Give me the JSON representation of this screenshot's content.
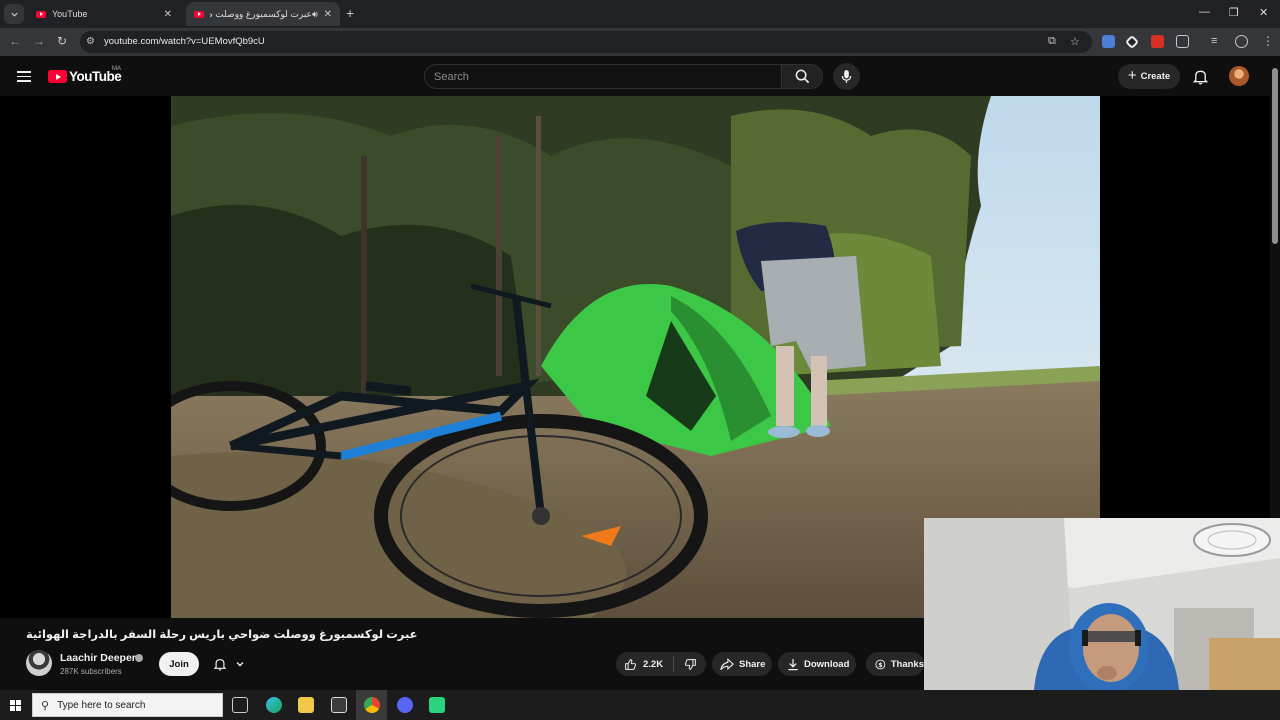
{
  "browser": {
    "tabs": [
      {
        "title": "YouTube",
        "active": false
      },
      {
        "title": "عبرت لوكسمبورغ ووصلت ض",
        "active": true,
        "audio": true
      }
    ],
    "new_tab_label": "+",
    "url": "youtube.com/watch?v=UEMovfQb9cU",
    "window_controls": {
      "minimize": "—",
      "restore": "❐",
      "close": "✕"
    }
  },
  "youtube": {
    "logo_text": "YouTube",
    "country_code": "MA",
    "search_placeholder": "Search",
    "create_label": "Create"
  },
  "video": {
    "title": "عبرت لوكسمبورغ ووصلت ضواحي باريس رحلة السفر بالدراجة الهوائية",
    "channel": {
      "name": "Laachir Deeper",
      "subscribers": "287K subscribers",
      "join_label": "Join"
    },
    "actions": {
      "likes": "2.2K",
      "share": "Share",
      "download": "Download",
      "thanks": "Thanks"
    }
  },
  "taskbar": {
    "search_placeholder": "Type here to search"
  },
  "colors": {
    "accent": "#ff0033",
    "background": "#0f0f0f",
    "tent_green": "#3cc846"
  }
}
